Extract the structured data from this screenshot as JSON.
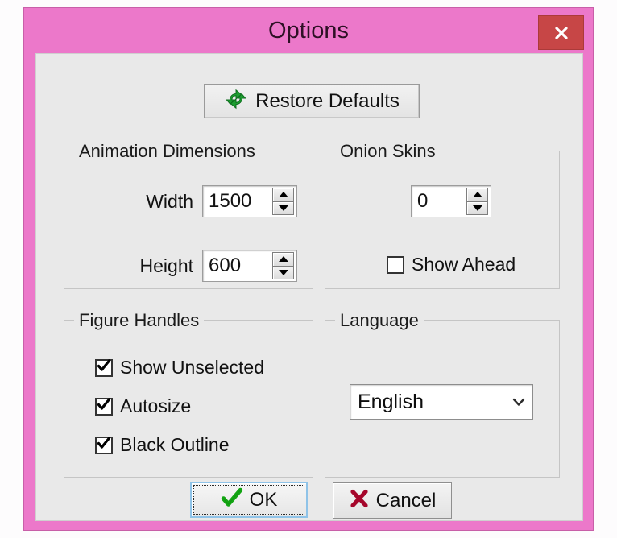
{
  "window": {
    "title": "Options",
    "frame_color": "#ec78ca",
    "client_color": "#e9e9e9",
    "close_button": {
      "name": "close-icon",
      "glyph": "x",
      "color": "#c74646"
    }
  },
  "toolbar": {
    "restore_defaults_label": "Restore Defaults",
    "restore_defaults_icon": "refresh-recycle-icon",
    "restore_defaults_icon_color": "#1e9e33"
  },
  "groups": {
    "animation_dimensions": {
      "title": "Animation Dimensions",
      "fields": [
        {
          "label": "Width",
          "value": "1500"
        },
        {
          "label": "Height",
          "value": "600"
        }
      ]
    },
    "onion_skins": {
      "title": "Onion Skins",
      "count_value": "0",
      "show_ahead": {
        "label": "Show Ahead",
        "checked": false
      }
    },
    "figure_handles": {
      "title": "Figure Handles",
      "items": [
        {
          "label": "Show Unselected",
          "checked": true
        },
        {
          "label": "Autosize",
          "checked": true
        },
        {
          "label": "Black Outline",
          "checked": true
        }
      ]
    },
    "language": {
      "title": "Language",
      "selected": "English",
      "options": [
        "English"
      ],
      "chevron_icon": "chevron-down-icon"
    }
  },
  "footer": {
    "ok_label": "OK",
    "ok_icon": "green-check-icon",
    "ok_icon_color": "#13a513",
    "ok_focused": true,
    "cancel_label": "Cancel",
    "cancel_icon": "red-x-icon",
    "cancel_icon_color": "#a5062b"
  }
}
